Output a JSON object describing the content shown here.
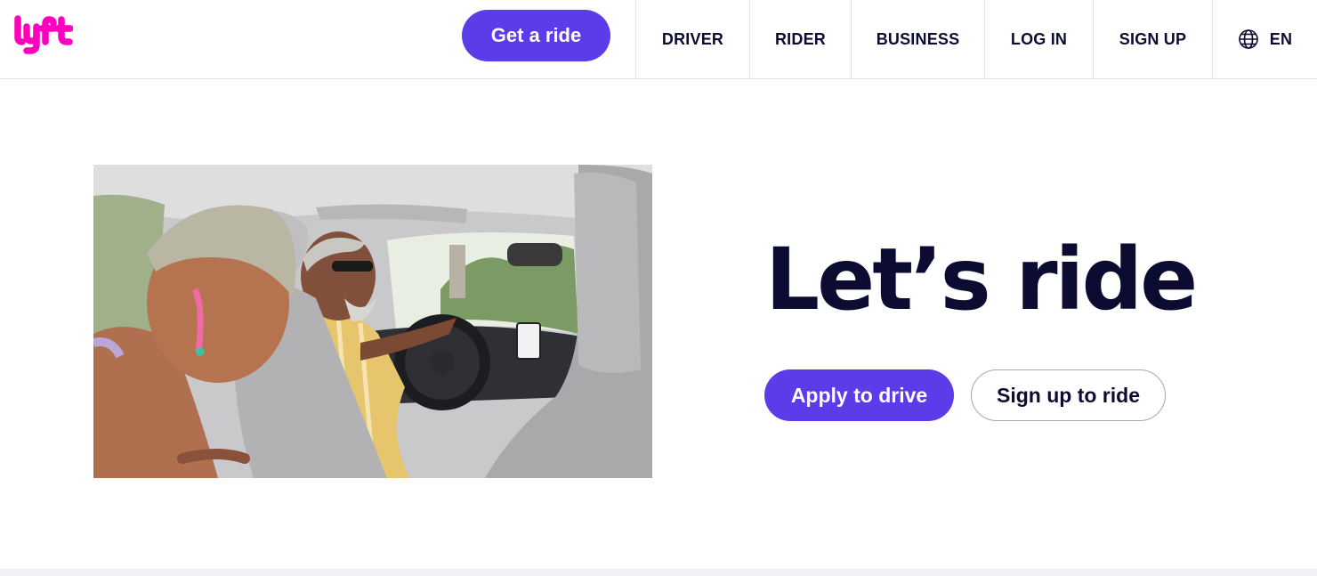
{
  "brand": {
    "logo_text": "lyft",
    "logo_icon": "lyft-logo",
    "brand_color": "#ff00bf",
    "accent_color": "#5b3ce8"
  },
  "header": {
    "get_ride_label": "Get a ride",
    "nav": {
      "driver": "DRIVER",
      "rider": "RIDER",
      "business": "BUSINESS",
      "login": "LOG IN",
      "signup": "SIGN UP",
      "language": "EN",
      "language_icon": "globe-icon"
    }
  },
  "hero": {
    "title": "Let’s ride",
    "photo_icon": "hero-photo-riders-in-car",
    "apply_label": "Apply to drive",
    "signup_ride_label": "Sign up to ride"
  }
}
